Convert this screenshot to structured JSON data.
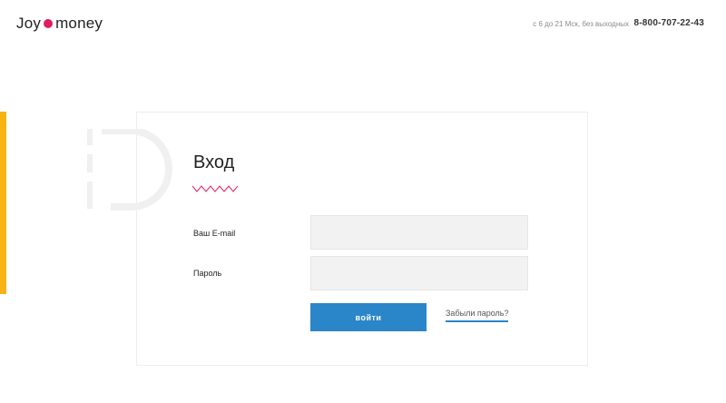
{
  "header": {
    "logo_text_left": "Joy",
    "logo_text_right": "money",
    "hours": "с 6 до 21 Мск, без выходных",
    "phone": "8-800-707-22-43"
  },
  "form": {
    "title": "Вход",
    "email_label": "Ваш E-mail",
    "email_value": "",
    "password_label": "Пароль",
    "password_value": "",
    "submit_label": "войти",
    "forgot_link": "Забыли пароль?"
  },
  "colors": {
    "accent_yellow": "#f6b313",
    "button_blue": "#2a86c8",
    "brand_pink": "#e21d5b"
  }
}
